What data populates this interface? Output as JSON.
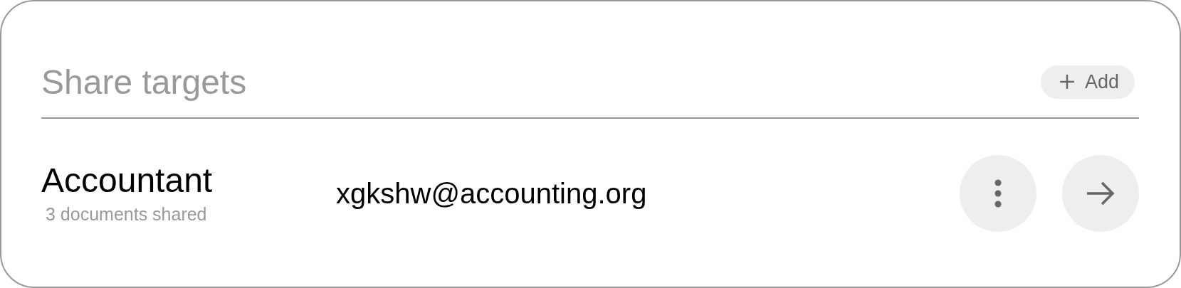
{
  "title": "Share targets",
  "add_button": {
    "label": "Add"
  },
  "targets": [
    {
      "name": "Accountant",
      "subtitle": "3 documents shared",
      "email": "xgkshw@accounting.org"
    }
  ]
}
